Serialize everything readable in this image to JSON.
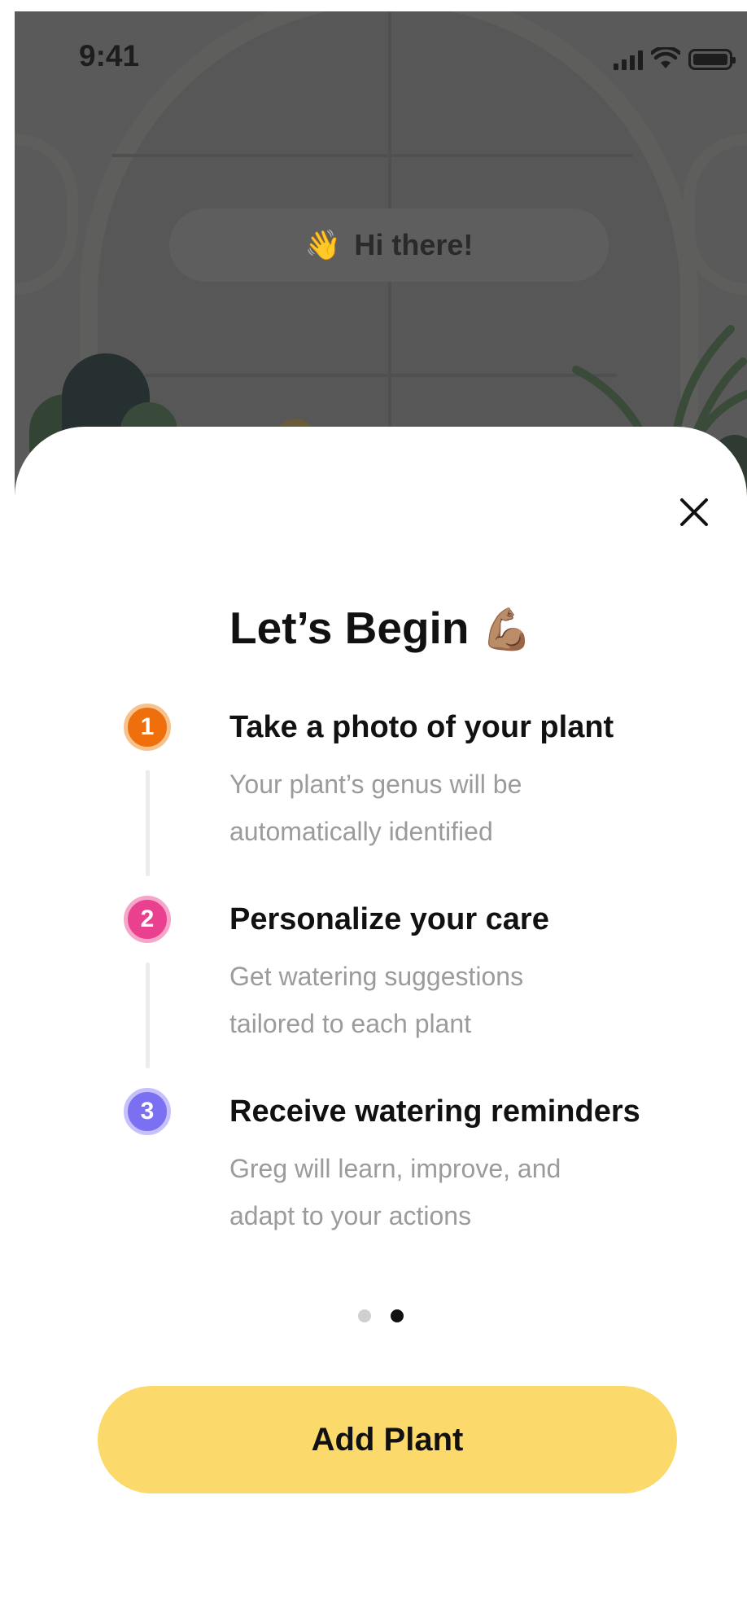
{
  "status_bar": {
    "time": "9:41"
  },
  "background": {
    "greeting_emoji": "👋",
    "greeting_text": "Hi there!"
  },
  "sheet": {
    "close_icon": "close-icon",
    "title": "Let’s Begin",
    "title_emoji": "💪🏽",
    "steps": [
      {
        "number": "1",
        "title": "Take a photo of your plant",
        "description_lines": [
          "Your plant’s genus will be",
          "automatically identified"
        ],
        "color": "#ee6f0b",
        "ring": "#f7c28c"
      },
      {
        "number": "2",
        "title": "Personalize your care",
        "description_lines": [
          "Get watering suggestions",
          "tailored to each plant"
        ],
        "color": "#e9408f",
        "ring": "#f6a6c8"
      },
      {
        "number": "3",
        "title": "Receive watering reminders",
        "description_lines": [
          "Greg will learn, improve, and",
          "adapt to your actions"
        ],
        "color": "#7c70f2",
        "ring": "#c6c1fa"
      }
    ],
    "pagination": {
      "total": 2,
      "active": 2
    },
    "primary_button": "Add Plant"
  },
  "colors": {
    "accent_button": "#fcd96b",
    "text_primary": "#111111",
    "text_secondary": "#9b9b9b"
  }
}
